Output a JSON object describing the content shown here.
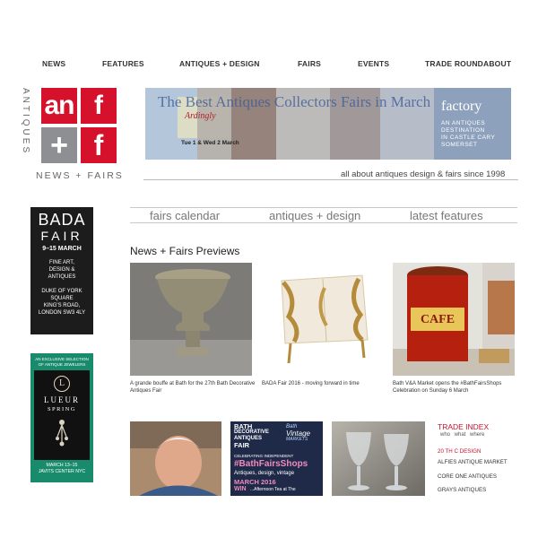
{
  "nav": {
    "items": [
      "NEWS",
      "FEATURES",
      "ANTIQUES + DESIGN",
      "FAIRS",
      "EVENTS",
      "TRADE ROUNDABOUT"
    ]
  },
  "brand": {
    "vertical_word": "ANTIQUES",
    "logo_letters": [
      "an",
      "f",
      "+",
      "f"
    ],
    "subtitle": "NEWS + FAIRS",
    "tagline": "all about antiques design & fairs since 1998"
  },
  "banner": {
    "headline": "The Best Antiques Collectors Fairs in March",
    "ardingly": "Ardingly",
    "dates": "Tue 1 & Wed 2 March",
    "factory_name": "factory",
    "factory_line1": "AN ANTIQUES",
    "factory_line2": "DESTINATION",
    "factory_line3": "IN CASTLE CARY",
    "factory_line4": "SOMERSET"
  },
  "subnav": {
    "items": [
      "fairs calendar",
      "antiques + design",
      "latest features"
    ]
  },
  "ads": {
    "bada": {
      "title": "BADA",
      "fair": "FAIR",
      "dates": "9–15 MARCH",
      "line1": "FINE ART,",
      "line2": "DESIGN &",
      "line3": "ANTIQUES",
      "addr1": "DUKE OF YORK",
      "addr2": "SQUARE",
      "addr3": "KING'S ROAD,",
      "addr4": "LONDON SW3 4LY"
    },
    "lueur": {
      "top1": "AN EXCLUSIVE SELECTION",
      "top2": "OF ANTIQUE JEWELERS",
      "monogram": "L",
      "name": "LUEUR",
      "season": "SPRING",
      "dates": "MARCH 13–15",
      "venue": "JAVITS CENTER NYC"
    }
  },
  "previews": {
    "heading": "News + Fairs Previews",
    "items": [
      {
        "caption": "A grande bouffe at Bath for the 27th Bath Decorative Antiques Fair"
      },
      {
        "caption": "BADA Fair 2016 - moving forward in time"
      },
      {
        "caption": "Bath V&A Market opens the #BathFairsShops Celebration on Sunday 6 March"
      }
    ],
    "cafe_sign": "CAFE"
  },
  "bath_poster": {
    "l1": "BATH",
    "l2": "DECORATIVE",
    "l3": "ANTIQUES",
    "l4": "FAIR",
    "r1": "Bath",
    "r2": "Vintage",
    "r3": "MARKETS",
    "hash_intro": "CELEBRATING INDEPENDENT",
    "hashtag": "#BathFairsShops",
    "tagline": "Antiques, design, vintage",
    "month": "MARCH 2016",
    "win": "WIN",
    "win_rest": "...Afternoon Tea at The"
  },
  "trade_index": {
    "title": "TRADE INDEX",
    "sub": "who what where",
    "items": [
      "20 TH C DESIGN",
      "ALFIES ANTIQUE MARKET",
      "CORE ONE ANTIQUES",
      "GRAYS ANTIQUES"
    ]
  },
  "colors": {
    "brand_red": "#d5112b",
    "brand_grey": "#8d8f92",
    "trade_red": "#c8102e",
    "lueur_green": "#198b6d"
  }
}
